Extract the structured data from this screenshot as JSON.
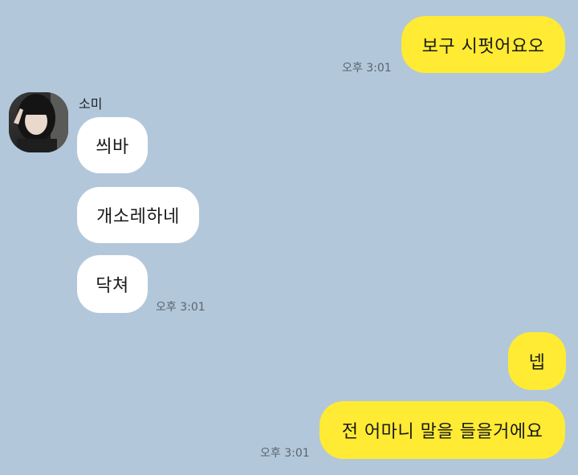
{
  "chat": {
    "contact_name": "소미",
    "messages": [
      {
        "sender": "me",
        "text": "보구 시펏어요오",
        "time": "오후 3:01"
      },
      {
        "sender": "소미",
        "text": "씌바"
      },
      {
        "sender": "소미",
        "text": "개소레하네"
      },
      {
        "sender": "소미",
        "text": "닥쳐",
        "time": "오후 3:01"
      },
      {
        "sender": "me",
        "text": "넵"
      },
      {
        "sender": "me",
        "text": "전 어마니 말을 들을거에요",
        "time": "오후 3:01"
      }
    ]
  },
  "colors": {
    "background": "#b2c7da",
    "my_bubble": "#ffeb33",
    "their_bubble": "#ffffff"
  }
}
